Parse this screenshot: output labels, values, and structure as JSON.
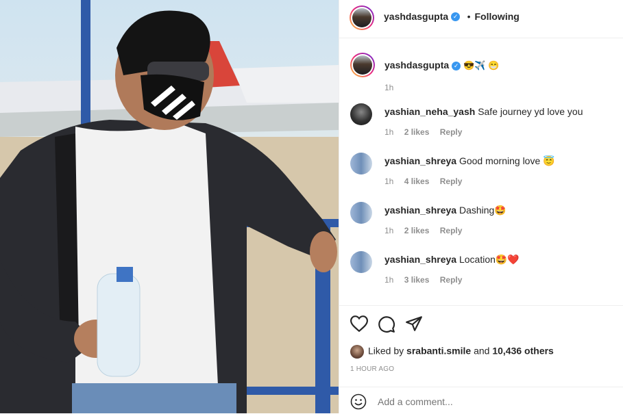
{
  "header": {
    "username": "yashdasgupta",
    "separator": "•",
    "follow_status": "Following"
  },
  "caption": {
    "username": "yashdasgupta",
    "emojis": "😎✈️ 😁",
    "time": "1h"
  },
  "comments": [
    {
      "username": "yashian_neha_yash",
      "text": "Safe journey yd love you",
      "time": "1h",
      "likes": "2 likes",
      "reply": "Reply"
    },
    {
      "username": "yashian_shreya",
      "text": "Good morning love 😇",
      "time": "1h",
      "likes": "4 likes",
      "reply": "Reply"
    },
    {
      "username": "yashian_shreya",
      "text": "Dashing🤩",
      "time": "1h",
      "likes": "2 likes",
      "reply": "Reply"
    },
    {
      "username": "yashian_shreya",
      "text": "Location🤩❤️",
      "time": "1h",
      "likes": "3 likes",
      "reply": "Reply"
    }
  ],
  "likes": {
    "prefix": "Liked by",
    "user": "srabanti.smile",
    "middle": "and",
    "others": "10,436 others"
  },
  "timestamp": "1 HOUR AGO",
  "comment_input": {
    "placeholder": "Add a comment..."
  },
  "icons": {
    "like": "heart-icon",
    "comment": "comment-bubble-icon",
    "share": "paper-plane-icon",
    "emoji": "smiley-icon",
    "verified": "verified-badge-icon"
  },
  "colors": {
    "verified": "#3897f0",
    "text": "#262626",
    "muted": "#8e8e8e"
  }
}
